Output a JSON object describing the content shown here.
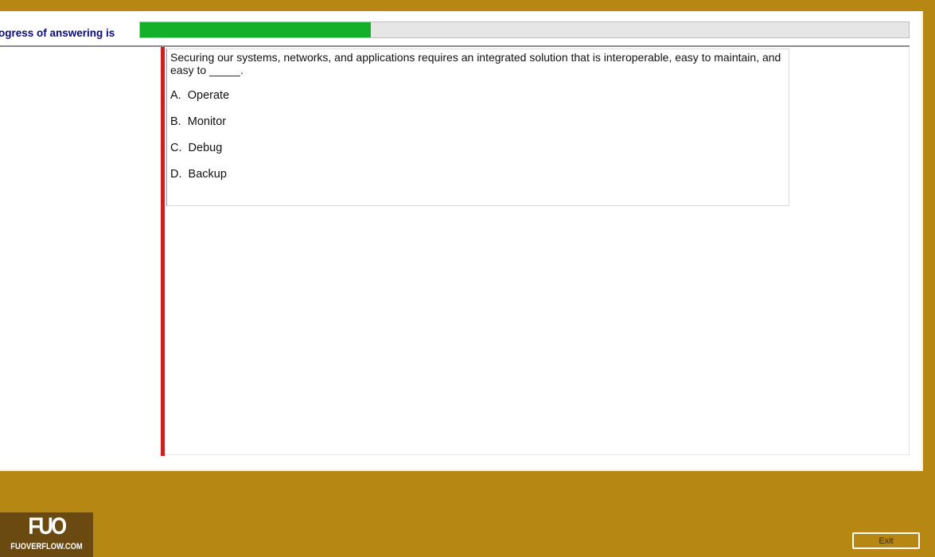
{
  "header": {
    "progress_label": "ogress of answering is",
    "progress_fraction": 0.3
  },
  "question": {
    "text": "Securing our systems, networks, and applications requires an integrated solution that is interoperable, easy to maintain, and easy to _____.",
    "options": [
      {
        "label": "A.  Operate"
      },
      {
        "label": "B.  Monitor"
      },
      {
        "label": "C.  Debug"
      },
      {
        "label": "D.  Backup"
      }
    ]
  },
  "footer": {
    "logo_mark": "FUO",
    "logo_text": "FUOVERFLOW.COM",
    "exit_label": "Exit"
  },
  "colors": {
    "background": "#b78713",
    "progress_fill": "#13b12a",
    "accent_bar": "#c82323",
    "label_text": "#0a0a7a"
  }
}
